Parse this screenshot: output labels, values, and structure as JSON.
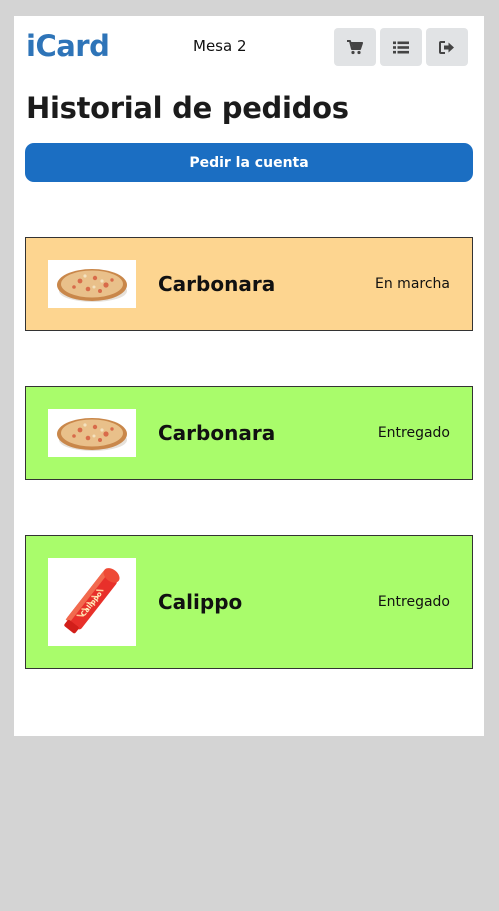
{
  "app": {
    "title": "iCard",
    "table": "Mesa 2"
  },
  "header_buttons": [
    {
      "icon": "cart-icon"
    },
    {
      "icon": "list-icon"
    },
    {
      "icon": "logout-icon"
    }
  ],
  "page": {
    "title": "Historial de pedidos",
    "bill_button_label": "Pedir la cuenta"
  },
  "orders": [
    {
      "name": "Carbonara",
      "status": "En marcha",
      "image": "pizza-icon",
      "status_color": "#fdd590"
    },
    {
      "name": "Carbonara",
      "status": "Entregado",
      "image": "pizza-icon",
      "status_color": "#a9fc6b"
    },
    {
      "name": "Calippo",
      "status": "Entregado",
      "image": "calippo-icon",
      "status_color": "#a9fc6b"
    }
  ],
  "colors": {
    "brand": "#2e74b8",
    "primary_button": "#1b6ec2",
    "in_progress": "#fdd590",
    "delivered": "#a9fc6b",
    "background": "#d4d4d4"
  }
}
